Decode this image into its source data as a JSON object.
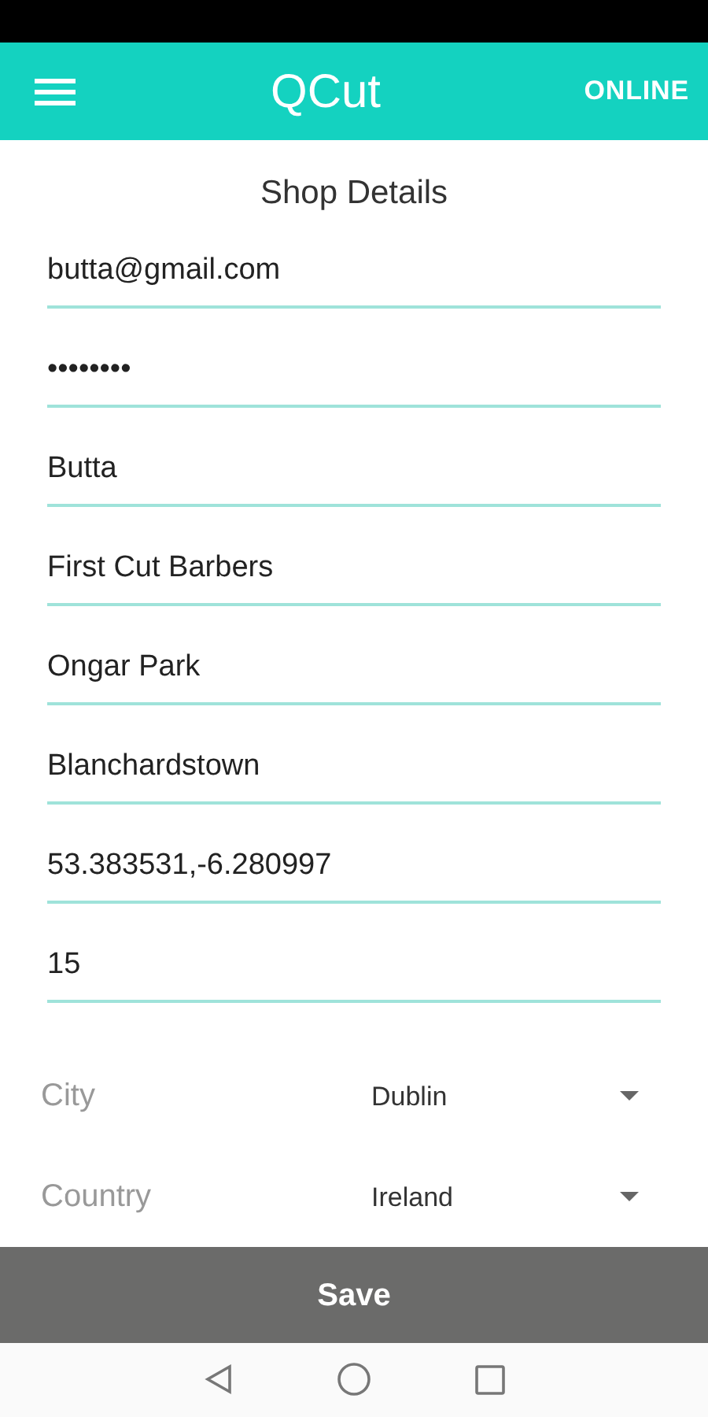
{
  "app_bar": {
    "title": "QCut",
    "status": "ONLINE"
  },
  "heading": "Shop Details",
  "fields": [
    {
      "value": "butta@gmail.com"
    },
    {
      "value": "••••••••"
    },
    {
      "value": "Butta"
    },
    {
      "value": "First Cut Barbers"
    },
    {
      "value": "Ongar Park"
    },
    {
      "value": "Blanchardstown"
    },
    {
      "value": "53.383531,-6.280997"
    },
    {
      "value": "15"
    }
  ],
  "dropdowns": [
    {
      "label": "City",
      "value": "Dublin"
    },
    {
      "label": "Country",
      "value": "Ireland"
    }
  ],
  "save_button": "Save"
}
